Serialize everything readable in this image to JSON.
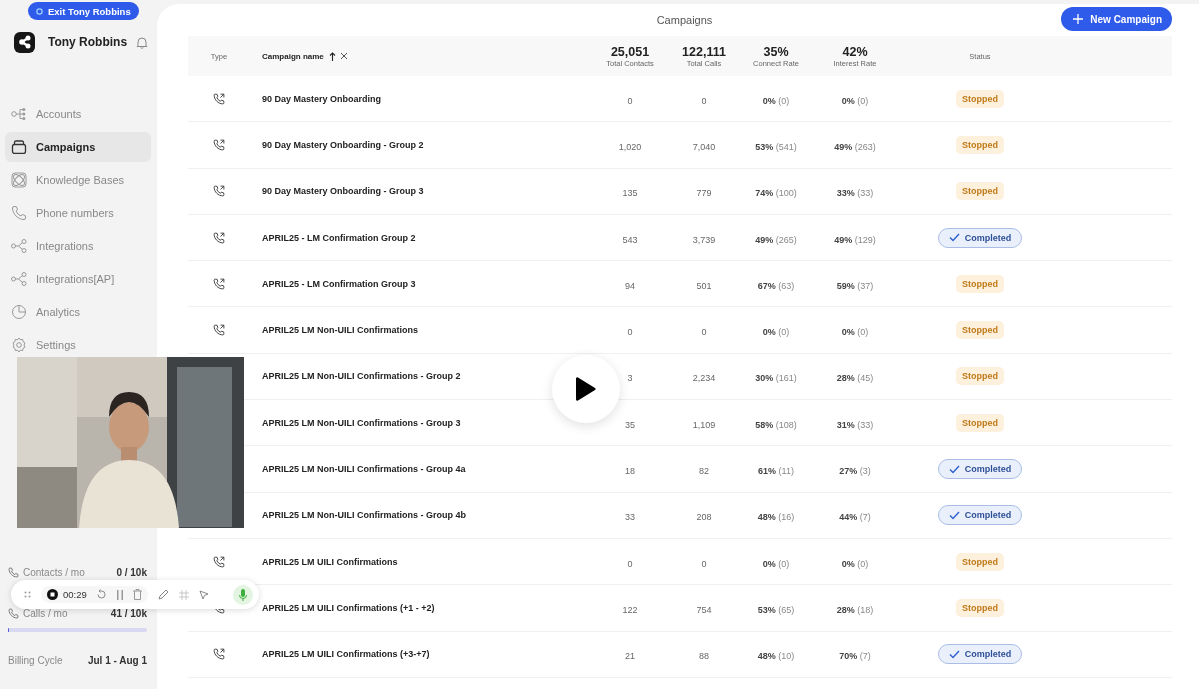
{
  "exit_button": {
    "label": "Exit Tony Robbins"
  },
  "account": {
    "name": "Tony Robbins"
  },
  "sidebar": {
    "items": [
      {
        "label": "Accounts",
        "selected": false
      },
      {
        "label": "Campaigns",
        "selected": true
      },
      {
        "label": "Knowledge Bases",
        "selected": false
      },
      {
        "label": "Phone numbers",
        "selected": false
      },
      {
        "label": "Integrations",
        "selected": false
      },
      {
        "label": "Integrations[AP]",
        "selected": false
      },
      {
        "label": "Analytics",
        "selected": false
      },
      {
        "label": "Settings",
        "selected": false
      }
    ]
  },
  "usage": [
    {
      "label": "Contacts / mo",
      "reading": "0 / 10k"
    },
    {
      "label": "Calls / mo",
      "reading": "41 / 10k",
      "level": 0.0041
    }
  ],
  "billing": {
    "label": "Billing Cycle",
    "value": "Jul 1 - Aug 1"
  },
  "page_title": "Campaigns",
  "new_button": {
    "label": "New Campaign"
  },
  "table": {
    "columns": [
      {
        "label": "Type"
      },
      {
        "label": "Campaign name",
        "sorted": true
      },
      {
        "total": "25,051",
        "label": "Total Contacts"
      },
      {
        "total": "122,111",
        "label": "Total Calls"
      },
      {
        "total": "35%",
        "label": "Connect Rate"
      },
      {
        "total": "42%",
        "label": "Interest Rate"
      },
      {
        "label": "Status"
      }
    ],
    "rows": [
      {
        "name": "90 Day Mastery Onboarding",
        "contacts": "0",
        "calls": "0",
        "connect": "0%",
        "connect_n": "(0)",
        "interest": "0%",
        "interest_n": "(0)",
        "status": {
          "label": "Stopped",
          "kind": "stopped"
        }
      },
      {
        "name": "90 Day Mastery Onboarding - Group 2",
        "contacts": "1,020",
        "calls": "7,040",
        "connect": "53%",
        "connect_n": "(541)",
        "interest": "49%",
        "interest_n": "(263)",
        "status": {
          "label": "Stopped",
          "kind": "stopped"
        }
      },
      {
        "name": "90 Day Mastery Onboarding - Group 3",
        "contacts": "135",
        "calls": "779",
        "connect": "74%",
        "connect_n": "(100)",
        "interest": "33%",
        "interest_n": "(33)",
        "status": {
          "label": "Stopped",
          "kind": "stopped"
        }
      },
      {
        "name": "APRIL25 - LM Confirmation Group 2",
        "contacts": "543",
        "calls": "3,739",
        "connect": "49%",
        "connect_n": "(265)",
        "interest": "49%",
        "interest_n": "(129)",
        "status": {
          "label": "Completed",
          "kind": "completed"
        }
      },
      {
        "name": "APRIL25 - LM Confirmation Group 3",
        "contacts": "94",
        "calls": "501",
        "connect": "67%",
        "connect_n": "(63)",
        "interest": "59%",
        "interest_n": "(37)",
        "status": {
          "label": "Stopped",
          "kind": "stopped"
        }
      },
      {
        "name": "APRIL25 LM Non-UILI Confirmations",
        "contacts": "0",
        "calls": "0",
        "connect": "0%",
        "connect_n": "(0)",
        "interest": "0%",
        "interest_n": "(0)",
        "status": {
          "label": "Stopped",
          "kind": "stopped"
        }
      },
      {
        "name": "APRIL25 LM Non-UILI Confirmations - Group 2",
        "type_icon": false,
        "contacts": "3",
        "calls": "2,234",
        "connect": "30%",
        "connect_n": "(161)",
        "interest": "28%",
        "interest_n": "(45)",
        "status": {
          "label": "Stopped",
          "kind": "stopped"
        }
      },
      {
        "name": "APRIL25 LM Non-UILI Confirmations - Group 3",
        "type_icon": false,
        "contacts": "35",
        "calls": "1,109",
        "connect": "58%",
        "connect_n": "(108)",
        "interest": "31%",
        "interest_n": "(33)",
        "status": {
          "label": "Stopped",
          "kind": "stopped"
        }
      },
      {
        "name": "APRIL25 LM Non-UILI Confirmations - Group 4a",
        "type_icon": false,
        "contacts": "18",
        "calls": "82",
        "connect": "61%",
        "connect_n": "(11)",
        "interest": "27%",
        "interest_n": "(3)",
        "status": {
          "label": "Completed",
          "kind": "completed"
        }
      },
      {
        "name": "APRIL25 LM Non-UILI Confirmations - Group 4b",
        "type_icon": false,
        "contacts": "33",
        "calls": "208",
        "connect": "48%",
        "connect_n": "(16)",
        "interest": "44%",
        "interest_n": "(7)",
        "status": {
          "label": "Completed",
          "kind": "completed"
        }
      },
      {
        "name": "APRIL25 LM UILI Confirmations",
        "contacts": "0",
        "calls": "0",
        "connect": "0%",
        "connect_n": "(0)",
        "interest": "0%",
        "interest_n": "(0)",
        "status": {
          "label": "Stopped",
          "kind": "stopped"
        }
      },
      {
        "name": "APRIL25 LM UILI Confirmations (+1 - +2)",
        "contacts": "122",
        "calls": "754",
        "connect": "53%",
        "connect_n": "(65)",
        "interest": "28%",
        "interest_n": "(18)",
        "status": {
          "label": "Stopped",
          "kind": "stopped"
        }
      },
      {
        "name": "APRIL25 LM UILI Confirmations (+3-+7)",
        "contacts": "21",
        "calls": "88",
        "connect": "48%",
        "connect_n": "(10)",
        "interest": "70%",
        "interest_n": "(7)",
        "status": {
          "label": "Completed",
          "kind": "completed"
        }
      }
    ]
  },
  "recorder": {
    "timer": "00:29"
  }
}
